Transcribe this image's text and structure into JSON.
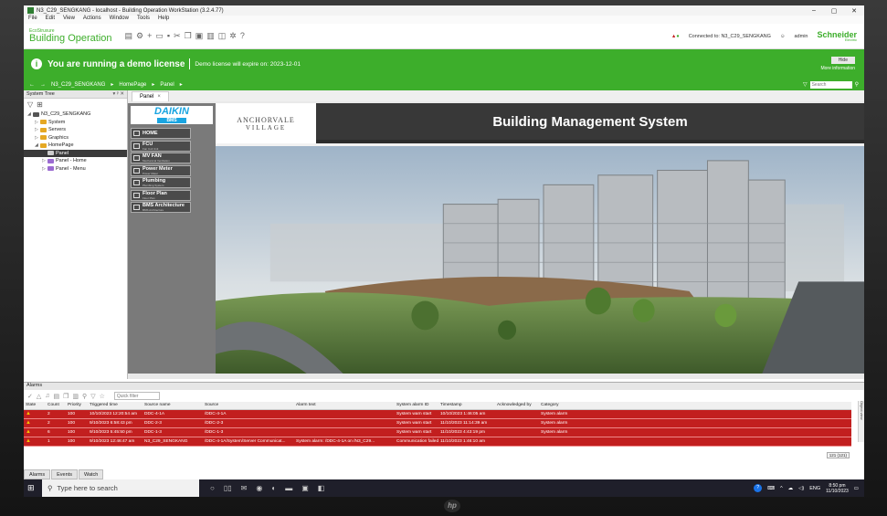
{
  "window": {
    "title": "N3_C29_SENGKANG - localhost - Building Operation WorkStation (3.2.4.77)",
    "controls": [
      "–",
      "▢",
      "✕"
    ]
  },
  "menu": [
    "File",
    "Edit",
    "View",
    "Actions",
    "Window",
    "Tools",
    "Help"
  ],
  "brand": {
    "small": "EcoStruxure",
    "big": "Building Operation"
  },
  "header": {
    "connected": "Connected to: N3_C29_SENGKANG",
    "user": "admin",
    "logo_main": "Schneider",
    "logo_sub": "Electric"
  },
  "license": {
    "main": "You are running a demo license",
    "sub": "Demo license will expire on: 2023-12-01",
    "hide": "Hide",
    "more": "More information"
  },
  "nav": {
    "breadcrumbs": [
      "N3_C29_SENGKANG",
      "HomePage",
      "Panel"
    ],
    "search_placeholder": "Search"
  },
  "system_tree": {
    "title": "System Tree",
    "controls": "▾ ᵖ ✕",
    "items": [
      {
        "label": "N3_C29_SENGKANG",
        "level": 0,
        "color": "#555555",
        "twisty": "◢",
        "selected": false
      },
      {
        "label": "System",
        "level": 1,
        "color": "#e5a823",
        "twisty": "▷",
        "selected": false
      },
      {
        "label": "Servers",
        "level": 1,
        "color": "#e5a823",
        "twisty": "▷",
        "selected": false
      },
      {
        "label": "Graphics",
        "level": 1,
        "color": "#e5a823",
        "twisty": "▷",
        "selected": false
      },
      {
        "label": "HomePage",
        "level": 1,
        "color": "#e5a823",
        "twisty": "◢",
        "selected": false
      },
      {
        "label": "Panel",
        "level": 2,
        "color": "#cccccc",
        "twisty": "",
        "selected": true
      },
      {
        "label": "Panel - Home",
        "level": 2,
        "color": "#9b6bd1",
        "twisty": "▷",
        "selected": false
      },
      {
        "label": "Panel - Menu",
        "level": 2,
        "color": "#9b6bd1",
        "twisty": "▷",
        "selected": false
      }
    ]
  },
  "tabs": [
    {
      "label": "Panel",
      "close": "×"
    }
  ],
  "daikin": {
    "logo": "DAIKIN",
    "logo_sub": "BMS",
    "menu": [
      {
        "label": "HOME",
        "sub": ""
      },
      {
        "label": "FCU",
        "sub": "Fan Coil Unit"
      },
      {
        "label": "MV FAN",
        "sub": "Mechanical Ventilation"
      },
      {
        "label": "Power Meter",
        "sub": "Power Meter"
      },
      {
        "label": "Plumbing",
        "sub": "Plumbing System"
      },
      {
        "label": "Floor Plan",
        "sub": "Floor Plan"
      },
      {
        "label": "BMS Architecture",
        "sub": "BMS Architecture"
      }
    ]
  },
  "hmi": {
    "logo_line1": "ANCHORVALE",
    "logo_line2": "VILLAGE",
    "title": "Building Management System"
  },
  "alarms": {
    "title": "Alarms",
    "quick_filter": "Quick filter",
    "columns": [
      "State",
      "Count",
      "Priority",
      "Triggered time",
      "Source name",
      "Source",
      "Alarm text",
      "System alarm ID",
      "Timestamp",
      "Acknowledged by",
      "Category"
    ],
    "rows": [
      [
        "",
        "2",
        "100",
        "10/10/2023 12:20:54 am",
        "DDC-4-1A",
        "/DDC-4-1A",
        "",
        "System warn start",
        "10/10/2023 1:46:05 am",
        "",
        "System alarm"
      ],
      [
        "",
        "2",
        "100",
        "9/10/2023 6:58:43 pm",
        "DDC-2-3",
        "/DDC-2-3",
        "",
        "System warn start",
        "11/10/2023 11:14:39 am",
        "",
        "System alarm"
      ],
      [
        "",
        "6",
        "100",
        "9/10/2023 5:45:50 pm",
        "DDC-1-3",
        "/DDC-1-3",
        "",
        "System warn start",
        "11/10/2023 4:43:19 pm",
        "",
        "System alarm"
      ],
      [
        "",
        "1",
        "100",
        "9/10/2023 12:46:47 am",
        "N3_C29_SENGKANG",
        "/DDC-4-1A/System/Server Communicat...",
        "System alarm: /DDC-4-1A on /N3_C29...",
        "Communication failed",
        "11/10/2023 1:46:10 am",
        "",
        ""
      ]
    ],
    "pager": "121 (121)",
    "tabs": [
      "Alarms",
      "Events",
      "Watch"
    ],
    "side_tab": "Object view"
  },
  "taskbar": {
    "search": "Type here to search",
    "lang": "ENG",
    "time": "8:50 pm",
    "date": "11/10/2023"
  },
  "colors": {
    "accent": "#3dae2b",
    "alarm_row": "#c21f1f",
    "daikin_blue": "#1aa5e1"
  }
}
